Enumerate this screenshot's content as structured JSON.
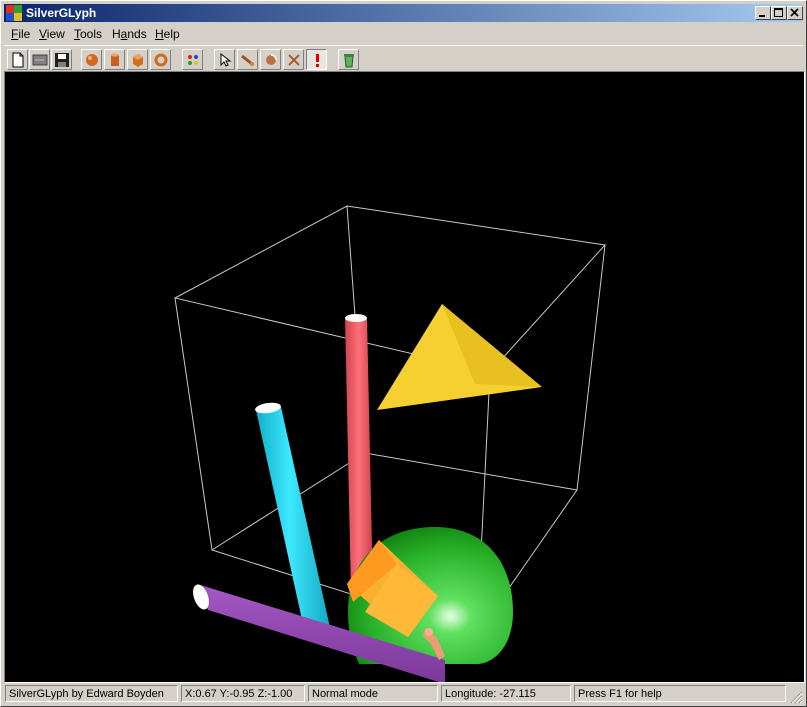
{
  "window": {
    "title": "SilverGLyph"
  },
  "menu": {
    "items": [
      {
        "label": "File"
      },
      {
        "label": "View"
      },
      {
        "label": "Tools"
      },
      {
        "label": "Hands"
      },
      {
        "label": "Help"
      }
    ]
  },
  "toolbar": {
    "tools": [
      {
        "icon": "new-document-icon"
      },
      {
        "icon": "open-icon"
      },
      {
        "icon": "save-icon"
      },
      {
        "icon": "sphere-icon"
      },
      {
        "icon": "cylinder-icon"
      },
      {
        "icon": "cube-icon"
      },
      {
        "icon": "torus-icon"
      },
      {
        "icon": "color-palette-icon"
      },
      {
        "icon": "pointer-icon"
      },
      {
        "icon": "move-icon"
      },
      {
        "icon": "rotate-icon"
      },
      {
        "icon": "scale-icon"
      },
      {
        "icon": "alert-icon"
      },
      {
        "icon": "recycle-icon"
      }
    ]
  },
  "status": {
    "author": "SilverGLyph by Edward Boyden",
    "coords": "X:0.67 Y:-0.95 Z:-1.00",
    "mode": "Normal mode",
    "longitude": "Longitude: -27.115",
    "help": "Press F1 for help"
  },
  "colors": {
    "title_start": "#0a246a",
    "title_end": "#a6caf0",
    "cyan_cylinder": "#22d8ee",
    "red_cylinder": "#f0606a",
    "purple_cylinder": "#9048b0",
    "yellow_triangle": "#f5d030",
    "green_sphere": "#30c030",
    "orange_cube": "#f5a020"
  }
}
